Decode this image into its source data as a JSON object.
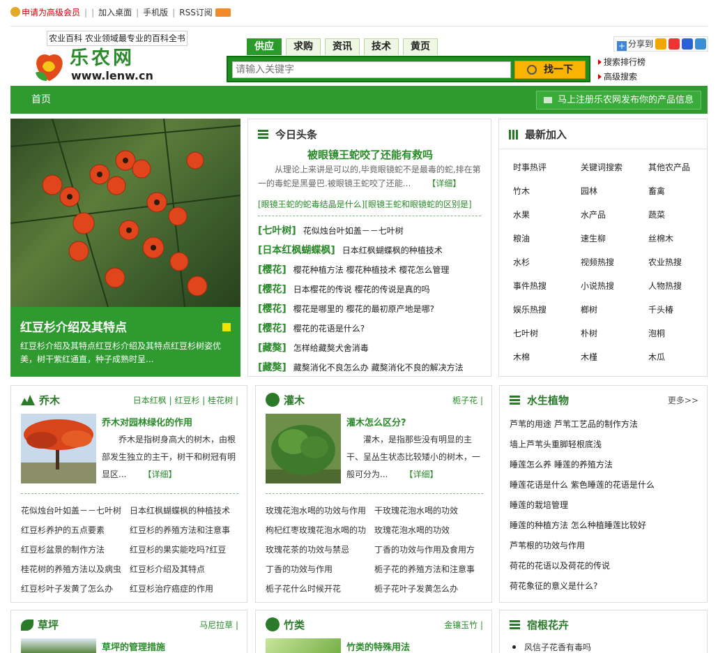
{
  "topbar": {
    "vip": "申请为高级会员",
    "add_desktop": "加入桌面",
    "mobile": "手机版",
    "rss": "RSS订阅"
  },
  "header": {
    "slogan": "农业百科 农业领域最专业的百科全书",
    "logo_title": "乐农网",
    "logo_url": "www.lenw.cn"
  },
  "search": {
    "tabs": [
      "供应",
      "求购",
      "资讯",
      "技术",
      "黄页"
    ],
    "placeholder": "请输入关键字",
    "button": "找一下",
    "links": [
      "搜索排行榜",
      "高级搜索"
    ]
  },
  "share": {
    "label": "分享到"
  },
  "nav": {
    "home": "首页",
    "register": "马上注册乐农网发布你的产品信息"
  },
  "hero": {
    "title": "红豆杉介绍及其特点",
    "desc": "红豆杉介绍及其特点红豆杉介绍及其特点红豆杉树姿优美，树干紫红通直，种子成熟时呈..."
  },
  "headline": {
    "title": "今日头条",
    "news_title": "被眼镜王蛇咬了还能有救吗",
    "news_desc": "从理论上来讲是可以的,毕竟眼镜蛇不是最毒的蛇,排在第一的毒蛇是黑曼巴.被眼镜王蛇咬了还能...",
    "detail": "【详细】",
    "related": "[眼镜王蛇的蛇毒结晶是什么][眼镜王蛇和眼镜蛇的区别是]",
    "items": [
      {
        "tag": "[七叶树]",
        "text": "花似烛台叶如盖－－七叶树"
      },
      {
        "tag": "[日本红枫蝴蝶枫]",
        "text": "日本红枫蝴蝶枫的种植技术"
      },
      {
        "tag": "[樱花]",
        "text": "樱花种植方法 樱花种植技术 樱花怎么管理"
      },
      {
        "tag": "[樱花]",
        "text": "日本樱花的传说 樱花的传说是真的吗"
      },
      {
        "tag": "[樱花]",
        "text": "樱花是哪里的 樱花的最初原产地是哪?"
      },
      {
        "tag": "[樱花]",
        "text": "樱花的花语是什么?"
      },
      {
        "tag": "[藏獒]",
        "text": "怎样给藏獒犬舍消毒"
      },
      {
        "tag": "[藏獒]",
        "text": "藏獒消化不良怎么办 藏獒消化不良的解决方法"
      }
    ]
  },
  "newest": {
    "title": "最新加入",
    "items": [
      "时事热评",
      "关键词搜索",
      "其他农产品",
      "竹木",
      "园林",
      "畜禽",
      "水果",
      "水产品",
      "蔬菜",
      "粮油",
      "速生柳",
      "丝棉木",
      "水杉",
      "视频热搜",
      "农业热搜",
      "事件热搜",
      "小说热搜",
      "人物热搜",
      "娱乐热搜",
      "榔树",
      "千头椿",
      "七叶树",
      "朴树",
      "泡桐",
      "木棉",
      "木槿",
      "木瓜"
    ]
  },
  "arbor": {
    "title": "乔木",
    "links": "日本红枫 | 红豆杉 | 桂花树 |",
    "news_title": "乔木对园林绿化的作用",
    "news_desc": "乔木是指树身高大的树木，由根部发生独立的主干，树干和树冠有明显区...",
    "detail": "【详细】",
    "rows": [
      [
        "花似烛台叶如盖－－七叶树",
        "日本红枫蝴蝶枫的种植技术"
      ],
      [
        "红豆杉养护的五点要素",
        "红豆杉的养殖方法和注意事"
      ],
      [
        "红豆杉盆景的制作方法",
        "红豆杉的果实能吃吗?红豆"
      ],
      [
        "桂花树的养殖方法以及病虫",
        "红豆杉介绍及其特点"
      ],
      [
        "红豆杉叶子发黄了怎么办",
        "红豆杉治疗癌症的作用"
      ]
    ]
  },
  "shrub": {
    "title": "灌木",
    "links": "栀子花 |",
    "news_title": "灌木怎么区分?",
    "news_desc": "灌木，是指那些没有明显的主干、呈丛生状态比较矮小的树木，一般可分为...",
    "detail": "【详细】",
    "rows": [
      [
        "玫瑰花泡水喝的功效与作用",
        "干玫瑰花泡水喝的功效"
      ],
      [
        "枸杞红枣玫瑰花泡水喝的功",
        "玫瑰花泡水喝的功效"
      ],
      [
        "玫瑰花茶的功效与禁忌",
        "丁香的功效与作用及食用方"
      ],
      [
        "丁香的功效与作用",
        "栀子花的养殖方法和注意事"
      ],
      [
        "栀子花什么时候开花",
        "栀子花叶子发黄怎么办"
      ]
    ]
  },
  "water": {
    "title": "水生植物",
    "more": "更多>>",
    "items": [
      "芦苇的用途 芦苇工艺品的制作方法",
      "墙上芦苇头重脚轻根底浅",
      "睡莲怎么养 睡莲的养殖方法",
      "睡莲花语是什么 紫色睡莲的花语是什么",
      "睡莲的栽培管理",
      "睡莲的种植方法 怎么种植睡莲比较好",
      "芦苇根的功效与作用",
      "荷花的花语以及荷花的传说",
      "荷花象征的意义是什么?"
    ]
  },
  "lawn": {
    "title": "草坪",
    "links": "马尼拉草 |",
    "news_title": "草坪的管理措施"
  },
  "bamboo": {
    "title": "竹类",
    "links": "金镶玉竹 |",
    "news_title": "竹类的特殊用法"
  },
  "perennial": {
    "title": "宿根花卉",
    "items": [
      "风信子花香有毒吗"
    ]
  },
  "colors": {
    "brand_green": "#2f9a2f",
    "accent_yellow": "#f8b400"
  }
}
